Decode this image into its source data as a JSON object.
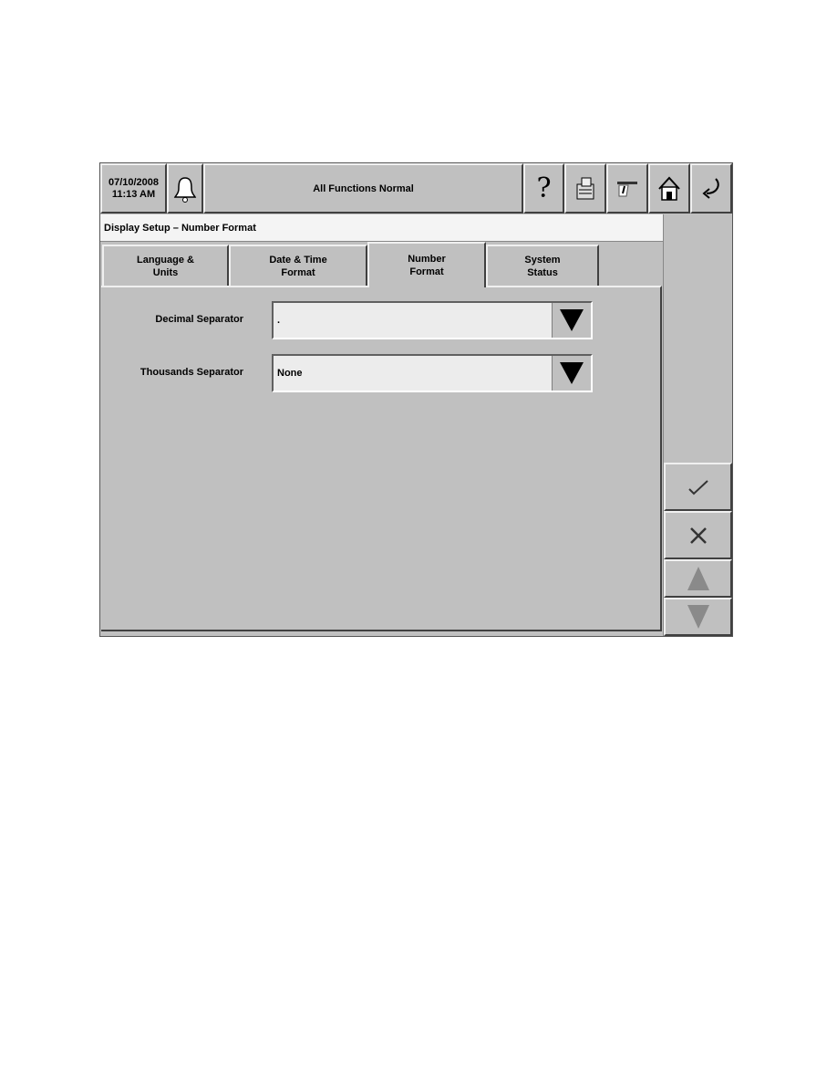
{
  "header": {
    "date": "07/10/2008",
    "time": "11:13 AM",
    "status": "All Functions Normal",
    "icons": [
      "bell-icon",
      "help-icon",
      "printer-icon",
      "ticket-icon",
      "home-icon",
      "back-icon"
    ]
  },
  "title": "Display Setup – Number Format",
  "tabs": [
    {
      "label1": "Language &",
      "label2": "Units"
    },
    {
      "label1": "Date & Time",
      "label2": "Format"
    },
    {
      "label1": "Number",
      "label2": "Format",
      "active": true
    },
    {
      "label1": "System",
      "label2": "Status"
    }
  ],
  "fields": [
    {
      "label": "Decimal Separator",
      "value": "."
    },
    {
      "label": "Thousands Separator",
      "value": "None"
    }
  ],
  "side": {
    "icons": [
      "checkmark-icon",
      "close-icon",
      "arrow-up-icon",
      "arrow-down-icon"
    ]
  }
}
